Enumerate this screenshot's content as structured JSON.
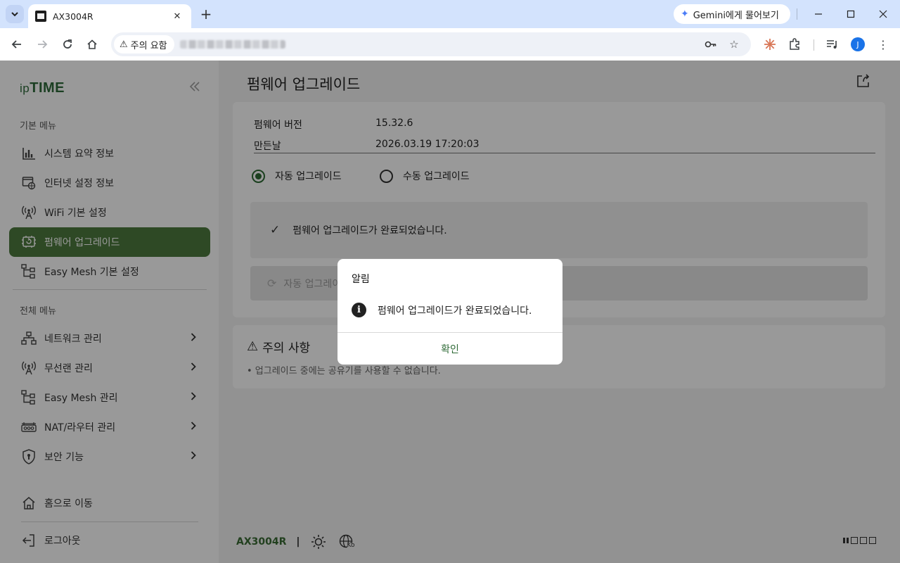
{
  "browser": {
    "tab_title": "AX3004R",
    "gemini_label": "Gemini에게 물어보기",
    "security_label": "주의 요함",
    "profile_initial": "J"
  },
  "sidebar": {
    "logo_ip": "ip",
    "logo_time": "TIME",
    "basic_menu_title": "기본 메뉴",
    "basic_items": [
      {
        "label": "시스템 요약 정보",
        "icon": "bar-chart-icon"
      },
      {
        "label": "인터넷 설정 정보",
        "icon": "globe-window-icon"
      },
      {
        "label": "WiFi 기본 설정",
        "icon": "wifi-antenna-icon"
      },
      {
        "label": "펌웨어 업그레이드",
        "icon": "firmware-chip-icon",
        "active": true
      },
      {
        "label": "Easy Mesh 기본 설정",
        "icon": "mesh-tree-icon"
      }
    ],
    "full_menu_title": "전체 메뉴",
    "full_items": [
      {
        "label": "네트워크 관리",
        "icon": "network-icon"
      },
      {
        "label": "무선랜 관리",
        "icon": "wifi-antenna-icon"
      },
      {
        "label": "Easy Mesh 관리",
        "icon": "mesh-tree-icon"
      },
      {
        "label": "NAT/라우터 관리",
        "icon": "router-icon"
      },
      {
        "label": "보안 기능",
        "icon": "shield-icon"
      }
    ],
    "home_label": "홈으로 이동",
    "logout_label": "로그아웃"
  },
  "main": {
    "title": "펌웨어 업그레이드",
    "firmware_version_label": "펌웨어 버전",
    "firmware_version_value": "15.32.6",
    "build_date_label": "만든날",
    "build_date_value": "2026.03.19 17:20:03",
    "radio_auto": "자동 업그레이드",
    "radio_manual": "수동 업그레이드",
    "status_message": "펌웨어 업그레이드가 완료되었습니다.",
    "auto_upgrade_button": "자동 업그레이드",
    "caution_title": "주의 사항",
    "caution_text": "• 업그레이드 중에는 공유기를 사용할 수 없습니다.",
    "footer_model": "AX3004R",
    "footer_lang": "Ko"
  },
  "dialog": {
    "title": "알림",
    "message": "펌웨어 업그레이드가 완료되었습니다.",
    "ok_label": "확인"
  },
  "colors": {
    "accent_green": "#4d7a3e",
    "chrome_blue": "#d3e3fd"
  }
}
